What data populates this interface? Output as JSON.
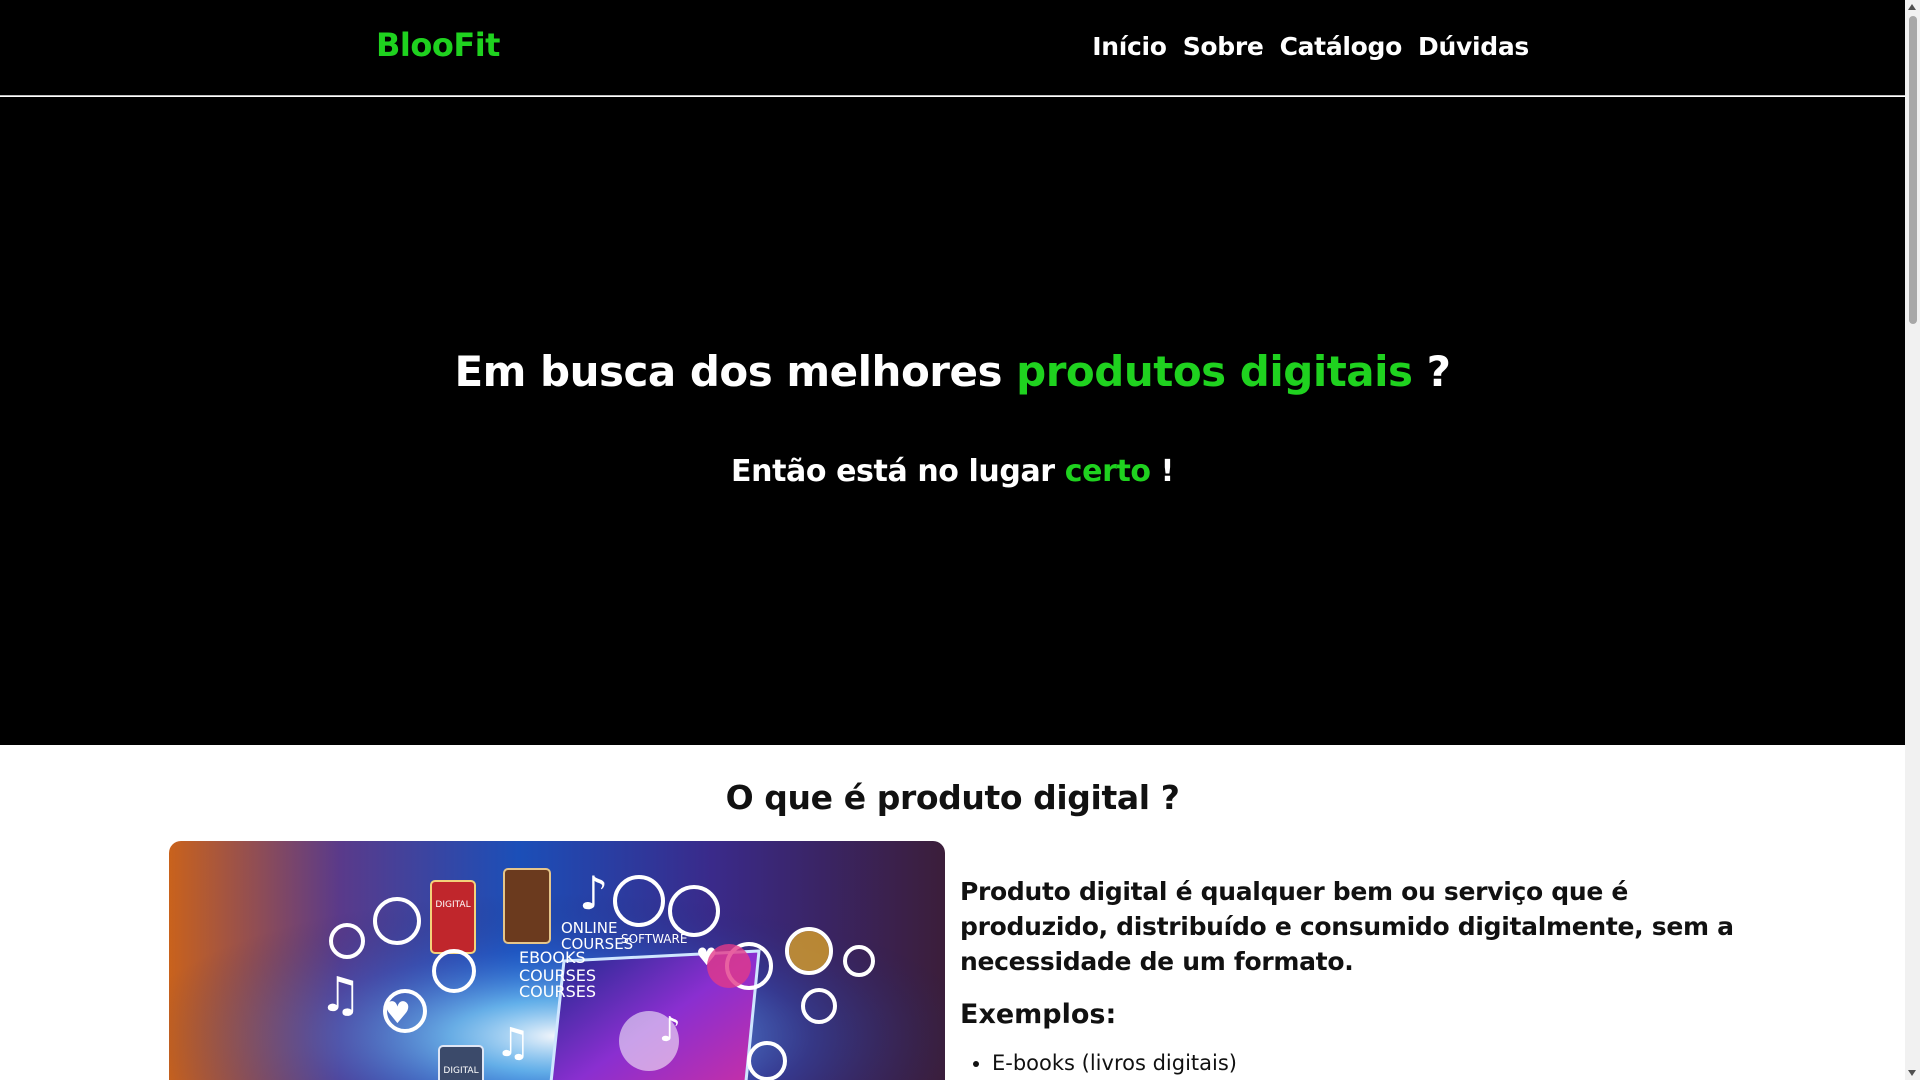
{
  "header": {
    "brand": "BlooFit",
    "nav": [
      "Início",
      "Sobre",
      "Catálogo",
      "Dúvidas"
    ]
  },
  "hero": {
    "title_pre": "Em busca dos melhores ",
    "title_accent": "produtos digitais",
    "title_post": " ?",
    "sub_pre": "Então está no lugar ",
    "sub_accent": "certo",
    "sub_post": " !"
  },
  "section": {
    "title": "O que é produto digital ?",
    "description": "Produto digital é qualquer bem ou serviço que é produzido, distribuído e consumido digitalmente, sem a necessidade de um formato.",
    "examples_heading": "Exemplos:",
    "examples": [
      "E-books (livros digitais)"
    ],
    "illustration_labels": [
      "DIGITAL",
      "EBOOKS",
      "COURSES",
      "COURSES",
      "ONLINE",
      "COURSES",
      "SOFTWARE",
      "DIGITAL"
    ]
  },
  "colors": {
    "accent": "#1fd21f",
    "hero_bg": "#000000",
    "page_bg": "#ffffff"
  }
}
